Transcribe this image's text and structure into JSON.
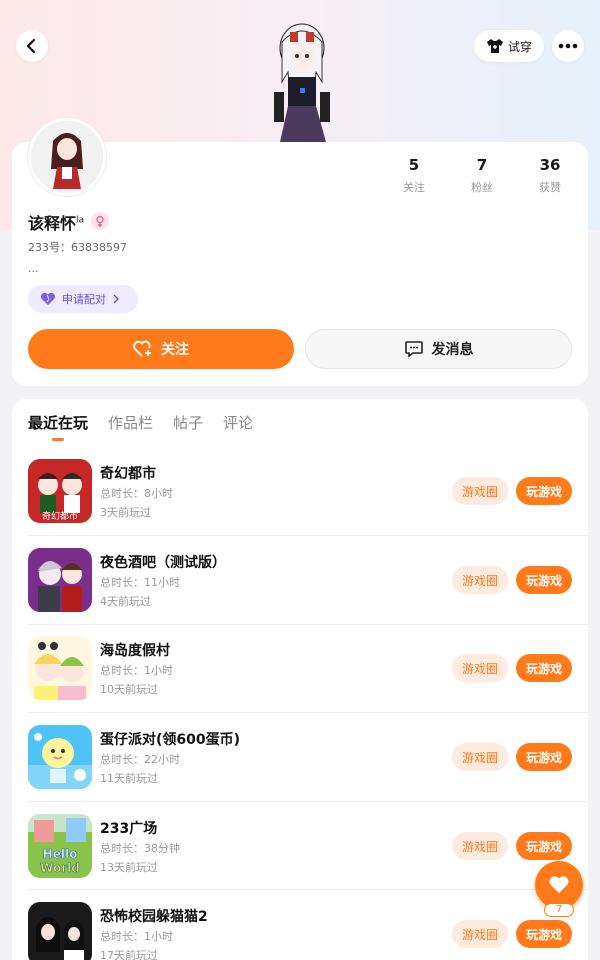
{
  "header": {
    "back_icon": "chevron-left-icon",
    "tryon_label": "试穿",
    "tryon_icon": "tshirt-icon",
    "more_icon": "more-dots-icon"
  },
  "profile": {
    "username": "该释怀",
    "username_suffix": "la",
    "gender_icon": "female-icon",
    "uid": "233号：63838597",
    "bio": "...",
    "pair_label": "申请配对",
    "pair_icon": "heart-icon",
    "stats": [
      {
        "num": "5",
        "label": "关注"
      },
      {
        "num": "7",
        "label": "粉丝"
      },
      {
        "num": "36",
        "label": "获赞"
      }
    ],
    "follow_label": "关注",
    "follow_icon": "add-heart-icon",
    "message_label": "发消息",
    "message_icon": "chat-icon"
  },
  "tabs": [
    {
      "label": "最近在玩",
      "active": true
    },
    {
      "label": "作品栏",
      "active": false
    },
    {
      "label": "帖子",
      "active": false
    },
    {
      "label": "评论",
      "active": false
    }
  ],
  "games": [
    {
      "title": "奇幻都市",
      "duration": "总时长：8小时",
      "last_played": "3天前玩过",
      "circle_label": "游戏圈",
      "play_label": "玩游戏"
    },
    {
      "title": "夜色酒吧（测试版）",
      "duration": "总时长：11小时",
      "last_played": "4天前玩过",
      "circle_label": "游戏圈",
      "play_label": "玩游戏"
    },
    {
      "title": "海岛度假村",
      "duration": "总时长：1小时",
      "last_played": "10天前玩过",
      "circle_label": "游戏圈",
      "play_label": "玩游戏"
    },
    {
      "title": "蛋仔派对(领600蛋币)",
      "duration": "总时长：22小时",
      "last_played": "11天前玩过",
      "circle_label": "游戏圈",
      "play_label": "玩游戏"
    },
    {
      "title": "233广场",
      "duration": "总时长：38分钟",
      "last_played": "13天前玩过",
      "circle_label": "游戏圈",
      "play_label": "玩游戏"
    },
    {
      "title": "恐怖校园躲猫猫2",
      "duration": "总时长：1小时",
      "last_played": "17天前玩过",
      "circle_label": "游戏圈",
      "play_label": "玩游戏"
    }
  ],
  "game_icon_texts": {
    "game0": "奇幻都市",
    "game4_line1": "Hello",
    "game4_line2": "World"
  },
  "fab": {
    "icon": "heart-icon",
    "count": "7"
  },
  "colors": {
    "accent": "#ff7a1a",
    "pair": "#6a4fd6"
  }
}
